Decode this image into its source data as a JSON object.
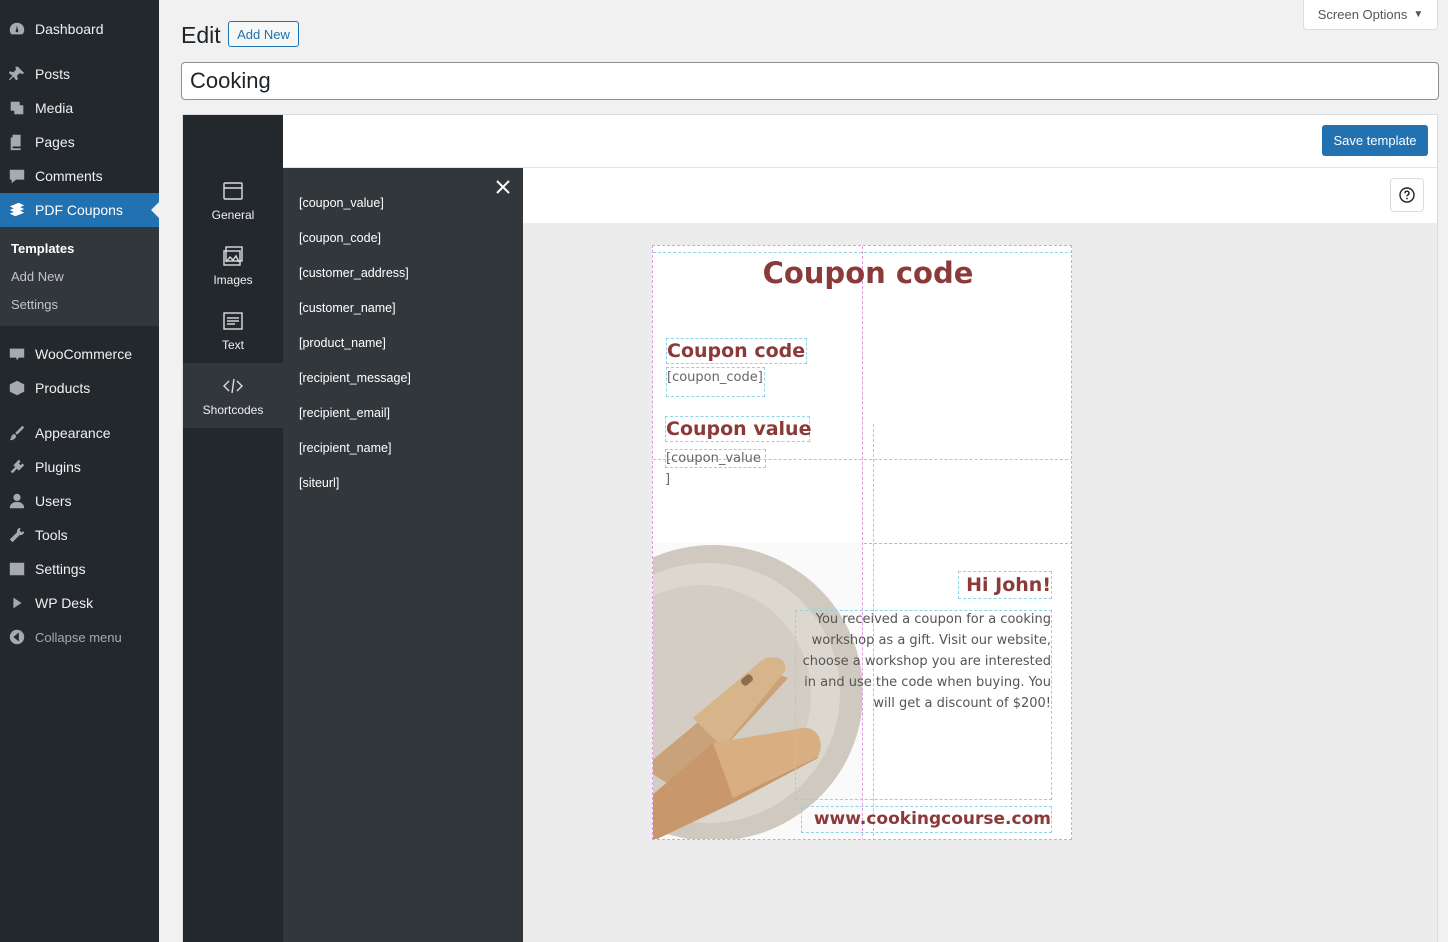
{
  "sidebar": {
    "items": [
      {
        "label": "Dashboard",
        "icon": "dashboard-icon"
      },
      {
        "label": "Posts",
        "icon": "pin-icon"
      },
      {
        "label": "Media",
        "icon": "media-icon"
      },
      {
        "label": "Pages",
        "icon": "pages-icon"
      },
      {
        "label": "Comments",
        "icon": "comments-icon"
      },
      {
        "label": "PDF Coupons",
        "icon": "coupons-icon"
      },
      {
        "label": "WooCommerce",
        "icon": "woo-icon"
      },
      {
        "label": "Products",
        "icon": "products-icon"
      },
      {
        "label": "Appearance",
        "icon": "brush-icon"
      },
      {
        "label": "Plugins",
        "icon": "plugin-icon"
      },
      {
        "label": "Users",
        "icon": "users-icon"
      },
      {
        "label": "Tools",
        "icon": "wrench-icon"
      },
      {
        "label": "Settings",
        "icon": "settings-icon"
      },
      {
        "label": "WP Desk",
        "icon": "play-icon"
      },
      {
        "label": "Collapse menu",
        "icon": "collapse-icon"
      }
    ],
    "submenu": [
      {
        "label": "Templates"
      },
      {
        "label": "Add New"
      },
      {
        "label": "Settings"
      }
    ]
  },
  "header": {
    "title": "Edit",
    "add_new": "Add New",
    "screen_options": "Screen Options"
  },
  "post_title": "Cooking",
  "editor": {
    "save": "Save template",
    "tools": [
      {
        "label": "General",
        "icon": "window-icon"
      },
      {
        "label": "Images",
        "icon": "images-icon"
      },
      {
        "label": "Text",
        "icon": "text-icon"
      },
      {
        "label": "Shortcodes",
        "icon": "code-icon"
      }
    ],
    "shortcodes": [
      "[coupon_value]",
      "[coupon_code]",
      "[customer_address]",
      "[customer_name]",
      "[product_name]",
      "[recipient_message]",
      "[recipient_email]",
      "[recipient_name]",
      "[siteurl]"
    ]
  },
  "coupon": {
    "title": "Coupon code",
    "code_heading": "Coupon code",
    "code_shortcode": "[coupon_code]",
    "value_heading": "Coupon value",
    "value_shortcode_1": "[coupon_value",
    "value_shortcode_2": "]",
    "greeting": "Hi John!",
    "message_lines": [
      "You received a coupon for a cooking",
      "workshop as a gift. Visit our website,",
      "choose a workshop you are interested",
      "in and use the code when buying. You",
      "will get a discount of $200!"
    ],
    "url": "www.cookingcourse.com"
  },
  "colors": {
    "accent": "#2271b1",
    "sidebar": "#23282d",
    "coupon_text": "#8b3a3a"
  }
}
